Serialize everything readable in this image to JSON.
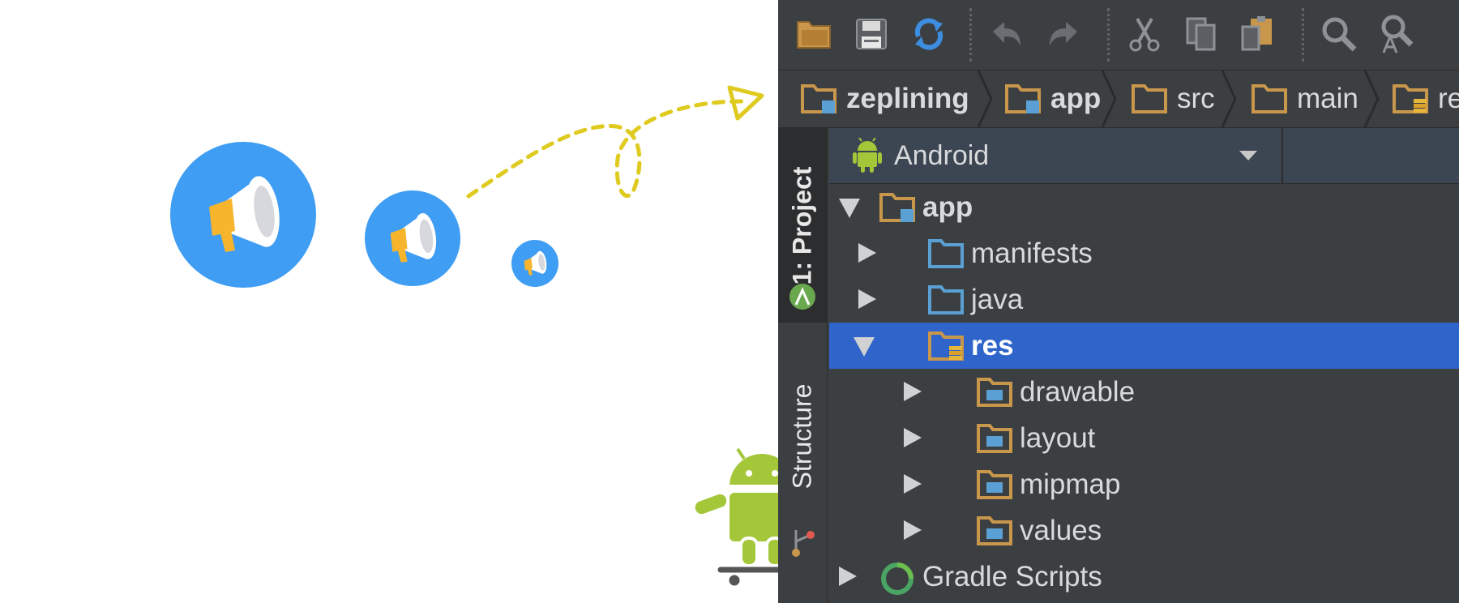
{
  "toolbar": {
    "buttons": [
      {
        "name": "open-folder-icon"
      },
      {
        "name": "save-icon"
      },
      {
        "name": "sync-icon"
      },
      {
        "name": "undo-icon"
      },
      {
        "name": "redo-icon"
      },
      {
        "name": "cut-icon"
      },
      {
        "name": "copy-icon"
      },
      {
        "name": "paste-icon"
      },
      {
        "name": "find-icon"
      },
      {
        "name": "replace-icon"
      }
    ]
  },
  "breadcrumb": {
    "items": [
      "zeplining",
      "app",
      "src",
      "main",
      "re"
    ]
  },
  "side_tabs": {
    "project": "1: Project",
    "structure": "Structure"
  },
  "view_selector": {
    "selected": "Android"
  },
  "tree": {
    "rows": [
      {
        "label": "app",
        "expanded": true
      },
      {
        "label": "manifests",
        "expanded": false
      },
      {
        "label": "java",
        "expanded": false
      },
      {
        "label": "res",
        "expanded": true,
        "selected": true
      },
      {
        "label": "drawable",
        "expanded": false
      },
      {
        "label": "layout",
        "expanded": false
      },
      {
        "label": "mipmap",
        "expanded": false
      },
      {
        "label": "values",
        "expanded": false
      },
      {
        "label": "Gradle Scripts",
        "expanded": false
      }
    ]
  },
  "colors": {
    "megaphone_circle": "#3f9df3",
    "megaphone_handle": "#f6b52d",
    "dashed_arrow": "#dfca1f",
    "android_green": "#a4c639",
    "ide_background": "#3c3f41",
    "selection": "#2f65ca"
  }
}
